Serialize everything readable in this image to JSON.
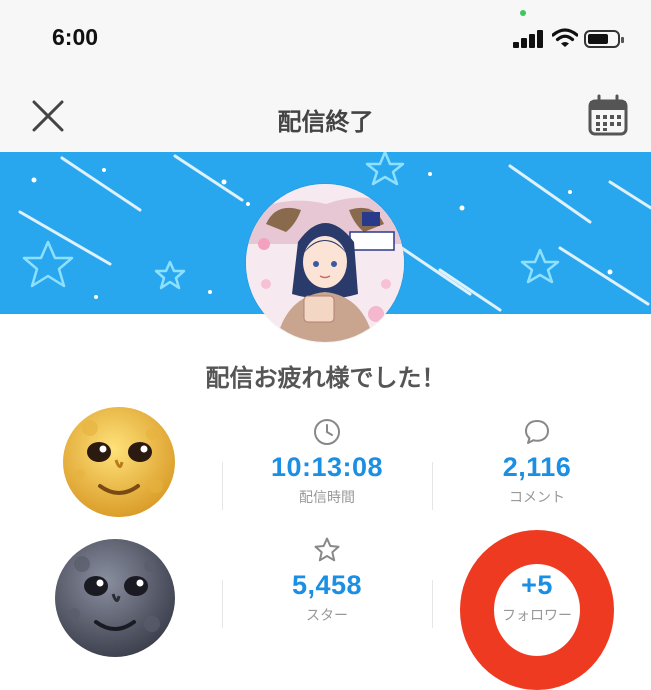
{
  "status_bar": {
    "time": "6:00"
  },
  "nav": {
    "title": "配信終了",
    "close_icon": "close-icon",
    "calendar_icon": "calendar-icon"
  },
  "banner": {
    "color": "#29a7ee"
  },
  "headline": "配信お疲れ様でした！",
  "stats": {
    "duration": {
      "value": "10:13:08",
      "label": "配信時間",
      "icon": "clock-icon"
    },
    "comments": {
      "value": "2,116",
      "label": "コメント",
      "icon": "comment-icon"
    },
    "stars": {
      "value": "5,458",
      "label": "スター",
      "icon": "star-icon"
    },
    "followers": {
      "value": "+5",
      "label": "フォロワー",
      "icon": "person-icon"
    }
  },
  "colors": {
    "accent": "#1a8fe3",
    "ring": "#ee3a21"
  }
}
